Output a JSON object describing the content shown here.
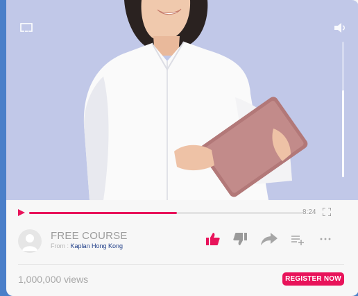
{
  "player": {
    "current_time": "8:24",
    "progress": 0.54,
    "volume": 0.64
  },
  "video": {
    "title": "FREE COURSE",
    "from_prefix": "From : ",
    "channel": "Kaplan Hong Kong",
    "views": "1,000,000 views",
    "cta_label": "REGISTER NOW"
  },
  "colors": {
    "accent": "#e8135a",
    "background": "#4a7fc9",
    "video_backdrop": "#c1c8e8",
    "channel_link": "#1c3b86"
  },
  "icons": [
    "cast-icon",
    "volume-icon",
    "play-icon",
    "fullscreen-icon",
    "thumbs-up-icon",
    "thumbs-down-icon",
    "share-icon",
    "add-to-queue-icon",
    "more-icon"
  ]
}
